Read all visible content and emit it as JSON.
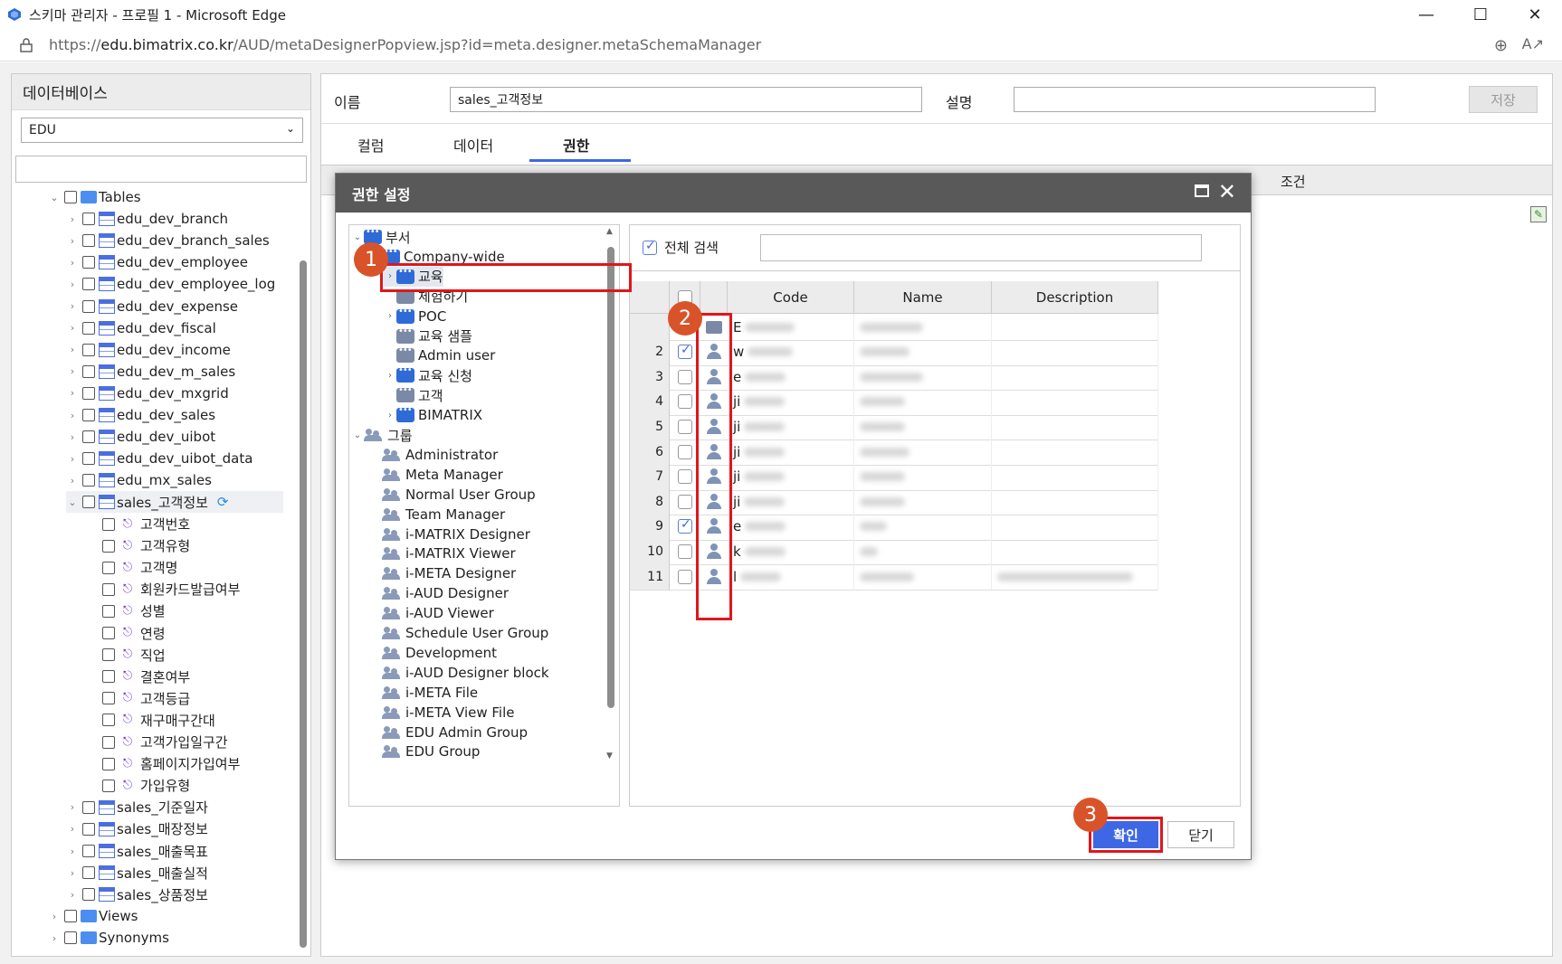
{
  "window": {
    "title": "스키마 관리자 - 프로필 1 - Microsoft Edge",
    "url_prefix": "https://",
    "url_host": "edu.bimatrix.co.kr",
    "url_path": "/AUD/metaDesignerPopview.jsp?id=meta.designer.metaSchemaManager"
  },
  "db_panel": {
    "header": "데이터베이스",
    "selected_db": "EDU",
    "tables_label": "Tables",
    "tables": [
      "edu_dev_branch",
      "edu_dev_branch_sales",
      "edu_dev_employee",
      "edu_dev_employee_log",
      "edu_dev_expense",
      "edu_dev_fiscal",
      "edu_dev_income",
      "edu_dev_m_sales",
      "edu_dev_mxgrid",
      "edu_dev_sales",
      "edu_dev_uibot",
      "edu_dev_uibot_data",
      "edu_mx_sales"
    ],
    "expanded_table": "sales_고객정보",
    "columns": [
      "고객번호",
      "고객유형",
      "고객명",
      "회원카드발급여부",
      "성별",
      "연령",
      "직업",
      "결혼여부",
      "고객등급",
      "재구매구간대",
      "고객가입일구간",
      "홈페이지가입여부",
      "가입유형"
    ],
    "more_tables": [
      "sales_기준일자",
      "sales_매장정보",
      "sales_매출목표",
      "sales_매출실적",
      "sales_상품정보"
    ],
    "views_label": "Views",
    "synonyms_label": "Synonyms"
  },
  "main": {
    "name_label": "이름",
    "name_value": "sales_고객정보",
    "desc_label": "설명",
    "desc_value": "",
    "save_label": "저장",
    "tabs": [
      "컬럼",
      "데이터",
      "권한"
    ],
    "active_tab": "권한",
    "condition_header": "조건"
  },
  "modal": {
    "title": "권한 설정",
    "tree": {
      "dept_label": "부서",
      "company": "Company-wide",
      "dept_items": [
        "교육",
        "체험하기",
        "POC",
        "교육 샘플",
        "Admin user",
        "교육 신청",
        "고객",
        "BIMATRIX"
      ],
      "group_label": "그룹",
      "groups": [
        "Administrator",
        "Meta Manager",
        "Normal User Group",
        "Team Manager",
        "i-MATRIX Designer",
        "i-MATRIX Viewer",
        "i-META Designer",
        "i-AUD Designer",
        "i-AUD Viewer",
        "Schedule User Group",
        "Development",
        "i-AUD Designer block",
        "i-META File",
        "i-META View File",
        "EDU Admin Group",
        "EDU Group"
      ]
    },
    "full_search_label": "전체 검색",
    "full_search_checked": true,
    "grid_headers": {
      "code": "Code",
      "name": "Name",
      "description": "Description"
    },
    "rows": [
      {
        "num": "",
        "checked": false,
        "icon": "chat-icon",
        "code": "E"
      },
      {
        "num": "2",
        "checked": true,
        "icon": "user-icon",
        "code": "w"
      },
      {
        "num": "3",
        "checked": false,
        "icon": "user-icon",
        "code": "e"
      },
      {
        "num": "4",
        "checked": false,
        "icon": "user-icon",
        "code": "ji"
      },
      {
        "num": "5",
        "checked": false,
        "icon": "user-icon",
        "code": "ji"
      },
      {
        "num": "6",
        "checked": false,
        "icon": "user-icon",
        "code": "ji"
      },
      {
        "num": "7",
        "checked": false,
        "icon": "user-icon",
        "code": "ji"
      },
      {
        "num": "8",
        "checked": false,
        "icon": "user-icon",
        "code": "ji"
      },
      {
        "num": "9",
        "checked": true,
        "icon": "user-icon",
        "code": "e"
      },
      {
        "num": "10",
        "checked": false,
        "icon": "user-icon",
        "code": "k"
      },
      {
        "num": "11",
        "checked": false,
        "icon": "user-icon",
        "code": "l"
      }
    ],
    "ok_label": "확인",
    "close_label": "닫기"
  },
  "annotations": [
    "1",
    "2",
    "3"
  ],
  "colors": {
    "accent": "#3e67e6",
    "highlight": "#e0161b",
    "badge": "#d9532a",
    "modal_header": "#595959"
  }
}
